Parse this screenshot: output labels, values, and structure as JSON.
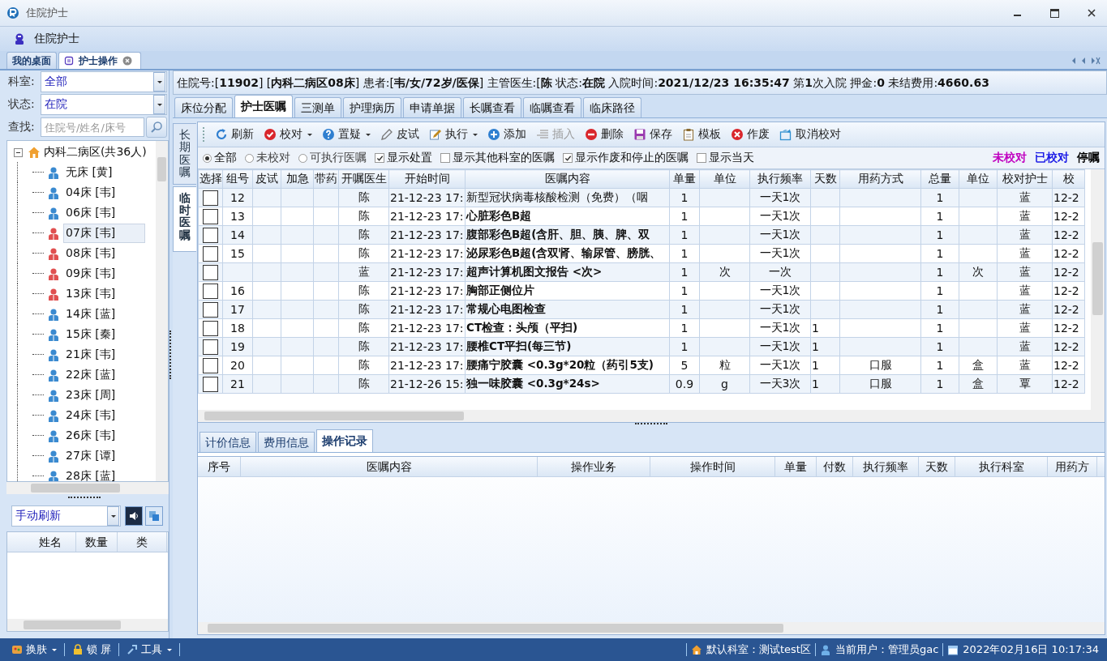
{
  "window": {
    "title": "住院护士"
  },
  "app_header": {
    "title": "住院护士"
  },
  "doc_tabs": [
    {
      "label": "我的桌面",
      "selected": false,
      "closable": false
    },
    {
      "label": "护士操作",
      "selected": true,
      "closable": true
    }
  ],
  "filters": [
    {
      "label": "科室:",
      "value": "全部"
    },
    {
      "label": "状态:",
      "value": "在院"
    }
  ],
  "search": {
    "label": "查找:",
    "placeholder": "住院号/姓名/床号"
  },
  "tree": {
    "label": "内科二病区(共36人)",
    "expanded": true,
    "children": [
      {
        "label": "无床 [黄]",
        "kind": "male",
        "selected": false
      },
      {
        "label": "04床 [韦]",
        "kind": "male",
        "selected": false
      },
      {
        "label": "06床 [韦]",
        "kind": "male",
        "selected": false
      },
      {
        "label": "07床 [韦]",
        "kind": "female",
        "selected": true
      },
      {
        "label": "08床 [韦]",
        "kind": "female",
        "selected": false
      },
      {
        "label": "09床 [韦]",
        "kind": "female",
        "selected": false
      },
      {
        "label": "13床 [韦]",
        "kind": "female",
        "selected": false
      },
      {
        "label": "14床 [蓝]",
        "kind": "male",
        "selected": false
      },
      {
        "label": "15床 [秦]",
        "kind": "male",
        "selected": false
      },
      {
        "label": "21床 [韦]",
        "kind": "male",
        "selected": false
      },
      {
        "label": "22床 [蓝]",
        "kind": "male",
        "selected": false
      },
      {
        "label": "23床 [周]",
        "kind": "male",
        "selected": false
      },
      {
        "label": "24床 [韦]",
        "kind": "male",
        "selected": false
      },
      {
        "label": "26床 [韦]",
        "kind": "male",
        "selected": false
      },
      {
        "label": "27床 [谭]",
        "kind": "male",
        "selected": false
      },
      {
        "label": "28床 [蓝]",
        "kind": "male",
        "selected": false
      }
    ]
  },
  "refresh_mode": {
    "value": "手动刷新"
  },
  "summary_grid": {
    "columns": [
      "姓名",
      "数量",
      "类"
    ]
  },
  "patient_info": "住院号:[**11902**] [**内科二病区08床**] 患者:[**韦/女/72岁/医保**] 主管医生:[**陈** 状态:**在院** 入院时间:**2021/12/23 16:35:47** 第**1**次入院 押金:**0** 未结费用:**4660.63**",
  "tabs": [
    {
      "label": "床位分配",
      "selected": false
    },
    {
      "label": "护士医嘱",
      "selected": true
    },
    {
      "label": "三测单",
      "selected": false
    },
    {
      "label": "护理病历",
      "selected": false
    },
    {
      "label": "申请单据",
      "selected": false
    },
    {
      "label": "长嘱查看",
      "selected": false
    },
    {
      "label": "临嘱查看",
      "selected": false
    },
    {
      "label": "临床路径",
      "selected": false
    }
  ],
  "side_tabs": [
    {
      "label": "长期医嘱",
      "selected": false
    },
    {
      "label": "临时医嘱",
      "selected": true
    }
  ],
  "toolbar": [
    {
      "label": "刷新",
      "kind": "refresh",
      "dropdown": false,
      "disabled": false
    },
    {
      "label": "校对",
      "kind": "check",
      "dropdown": true,
      "disabled": false
    },
    {
      "label": "置疑",
      "kind": "question",
      "dropdown": true,
      "disabled": false
    },
    {
      "label": "皮试",
      "kind": "pen",
      "dropdown": false,
      "disabled": false
    },
    {
      "label": "执行",
      "kind": "edit",
      "dropdown": true,
      "disabled": false
    },
    {
      "label": "添加",
      "kind": "add",
      "dropdown": false,
      "disabled": false
    },
    {
      "label": "插入",
      "kind": "insert",
      "dropdown": false,
      "disabled": true
    },
    {
      "label": "删除",
      "kind": "delete",
      "dropdown": false,
      "disabled": false
    },
    {
      "label": "保存",
      "kind": "save",
      "dropdown": false,
      "disabled": false
    },
    {
      "label": "模板",
      "kind": "template",
      "dropdown": false,
      "disabled": false
    },
    {
      "label": "作废",
      "kind": "void",
      "dropdown": false,
      "disabled": false
    },
    {
      "label": "取消校对",
      "kind": "undo",
      "dropdown": false,
      "disabled": false
    }
  ],
  "order_filters": [
    {
      "label": "全部",
      "kind": "radio",
      "selected": true
    },
    {
      "label": "未校对",
      "kind": "radio",
      "selected": false
    },
    {
      "label": "可执行医嘱",
      "kind": "radio",
      "selected": false
    },
    {
      "label": "显示处置",
      "kind": "checkbox",
      "checked": true
    },
    {
      "label": "显示其他科室的医嘱",
      "kind": "checkbox",
      "checked": false
    },
    {
      "label": "显示作废和停止的医嘱",
      "kind": "checkbox",
      "checked": true
    },
    {
      "label": "显示当天",
      "kind": "checkbox",
      "checked": false
    }
  ],
  "legend": [
    {
      "label": "未校对",
      "color": "#c000c0"
    },
    {
      "label": "已校对",
      "color": "#1a1ae6"
    },
    {
      "label": "停嘱",
      "color": "#000000"
    }
  ],
  "table": {
    "columns": [
      "选择",
      "组号",
      "皮试",
      "加急",
      "带药",
      "开嘱医生",
      "开始时间",
      "医嘱内容",
      "单量",
      "单位",
      "执行频率",
      "天数",
      "用药方式",
      "总量",
      "单位",
      "校对护士",
      "校"
    ],
    "rows": [
      {
        "checked": false,
        "group": "12",
        "doctor": "陈",
        "start": "21-12-23 17:",
        "content": "新型冠状病毒核酸检测（免费）（咽",
        "bold": false,
        "dose": "1",
        "freq": "一天1次",
        "total": "1",
        "nurse": "蓝",
        "check_time": "12-2"
      },
      {
        "checked": false,
        "group": "13",
        "doctor": "陈",
        "start": "21-12-23 17:",
        "content": "心脏彩色B超",
        "bold": true,
        "dose": "1",
        "freq": "一天1次",
        "total": "1",
        "nurse": "蓝",
        "check_time": "12-2"
      },
      {
        "checked": false,
        "group": "14",
        "doctor": "陈",
        "start": "21-12-23 17:",
        "content": "腹部彩色B超(含肝、胆、胰、脾、双",
        "bold": true,
        "dose": "1",
        "freq": "一天1次",
        "total": "1",
        "nurse": "蓝",
        "check_time": "12-2"
      },
      {
        "checked": false,
        "group": "15",
        "doctor": "陈",
        "start": "21-12-23 17:",
        "content": "泌尿彩色B超(含双肾、输尿管、膀胱、",
        "bold": true,
        "dose": "1",
        "freq": "一天1次",
        "total": "1",
        "nurse": "蓝",
        "check_time": "12-2"
      },
      {
        "checked": false,
        "doctor": "蓝",
        "start": "21-12-23 17:",
        "content": "超声计算机图文报告 <次>",
        "bold": true,
        "dose": "1",
        "unit": "次",
        "freq": "一次",
        "total": "1",
        "unit2": "次",
        "nurse": "蓝",
        "check_time": "12-2"
      },
      {
        "checked": false,
        "group": "16",
        "doctor": "陈",
        "start": "21-12-23 17:",
        "content": "胸部正侧位片",
        "bold": true,
        "dose": "1",
        "freq": "一天1次",
        "total": "1",
        "nurse": "蓝",
        "check_time": "12-2"
      },
      {
        "checked": false,
        "group": "17",
        "doctor": "陈",
        "start": "21-12-23 17:",
        "content": "常规心电图检查",
        "bold": true,
        "dose": "1",
        "freq": "一天1次",
        "total": "1",
        "nurse": "蓝",
        "check_time": "12-2"
      },
      {
        "checked": false,
        "group": "18",
        "doctor": "陈",
        "start": "21-12-23 17:",
        "content": "CT检查：头颅（平扫)",
        "bold": true,
        "dose": "1",
        "freq": "一天1次",
        "days": "1",
        "total": "1",
        "nurse": "蓝",
        "check_time": "12-2"
      },
      {
        "checked": false,
        "group": "19",
        "doctor": "陈",
        "start": "21-12-23 17:",
        "content": "腰椎CT平扫(每三节)",
        "bold": true,
        "dose": "1",
        "freq": "一天1次",
        "days": "1",
        "total": "1",
        "nurse": "蓝",
        "check_time": "12-2"
      },
      {
        "checked": false,
        "group": "20",
        "doctor": "陈",
        "start": "21-12-23 17:",
        "content": "腰痛宁胶囊 <0.3g*20粒（药引5支)",
        "bold": true,
        "dose": "5",
        "unit": "粒",
        "freq": "一天1次",
        "days": "1",
        "route": "口服",
        "total": "1",
        "unit2": "盒",
        "nurse": "蓝",
        "check_time": "12-2"
      },
      {
        "checked": false,
        "group": "21",
        "doctor": "陈",
        "start": "21-12-26 15:",
        "content": "独一味胶囊 <0.3g*24s>",
        "bold": true,
        "dose": "0.9",
        "unit": "g",
        "freq": "一天3次",
        "days": "1",
        "route": "口服",
        "total": "1",
        "unit2": "盒",
        "nurse": "覃",
        "check_time": "12-2"
      }
    ]
  },
  "bottom_tabs": [
    {
      "label": "计价信息",
      "selected": false
    },
    {
      "label": "费用信息",
      "selected": false
    },
    {
      "label": "操作记录",
      "selected": true
    }
  ],
  "log_table": {
    "columns": [
      "序号",
      "医嘱内容",
      "操作业务",
      "操作时间",
      "单量",
      "付数",
      "执行频率",
      "天数",
      "执行科室",
      "用药方"
    ]
  },
  "status_left": [
    {
      "label": "换肤",
      "kind": "skin",
      "dropdown": true
    },
    {
      "label": "锁 屏",
      "kind": "lock",
      "dropdown": false
    },
    {
      "label": "工具",
      "kind": "tools",
      "dropdown": true
    }
  ],
  "status_right": [
    {
      "label": "默认科室：测试test区",
      "kind": "home"
    },
    {
      "label": "当前用户：管理员gac",
      "kind": "user"
    },
    {
      "label": "2022年02月16日 10:17:34",
      "kind": "calendar"
    }
  ]
}
